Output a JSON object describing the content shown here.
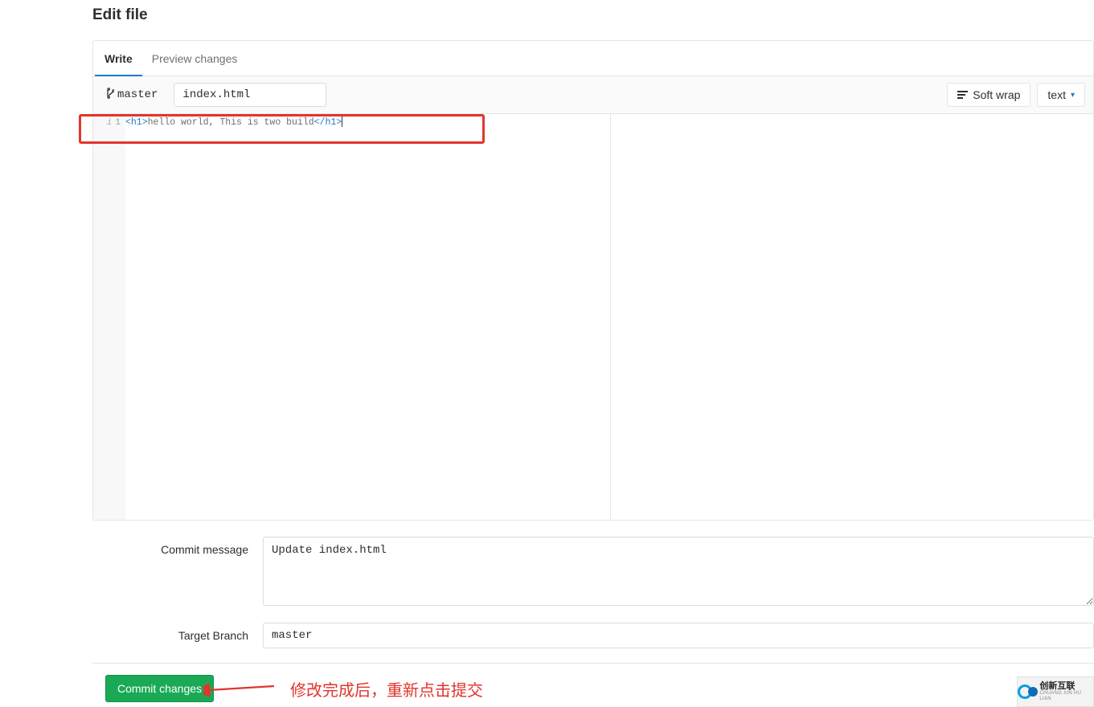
{
  "page": {
    "title": "Edit file"
  },
  "tabs": {
    "write": "Write",
    "preview": "Preview changes"
  },
  "file_bar": {
    "branch": "master",
    "filename": "index.html",
    "soft_wrap": "Soft wrap",
    "format": "text"
  },
  "editor": {
    "line_number": "1",
    "code_tag_open": "<h1>",
    "code_text": "hello world, This is two build",
    "code_tag_close": "</h1>"
  },
  "commit": {
    "label": "Commit message",
    "message": "Update index.html",
    "target_label": "Target Branch",
    "target_branch": "master"
  },
  "footer": {
    "commit_btn": "Commit changes"
  },
  "annotation": {
    "text": "修改完成后，重新点击提交"
  },
  "watermark": {
    "big": "创新互联",
    "small": "CHUANG XIN HU LIAN"
  }
}
